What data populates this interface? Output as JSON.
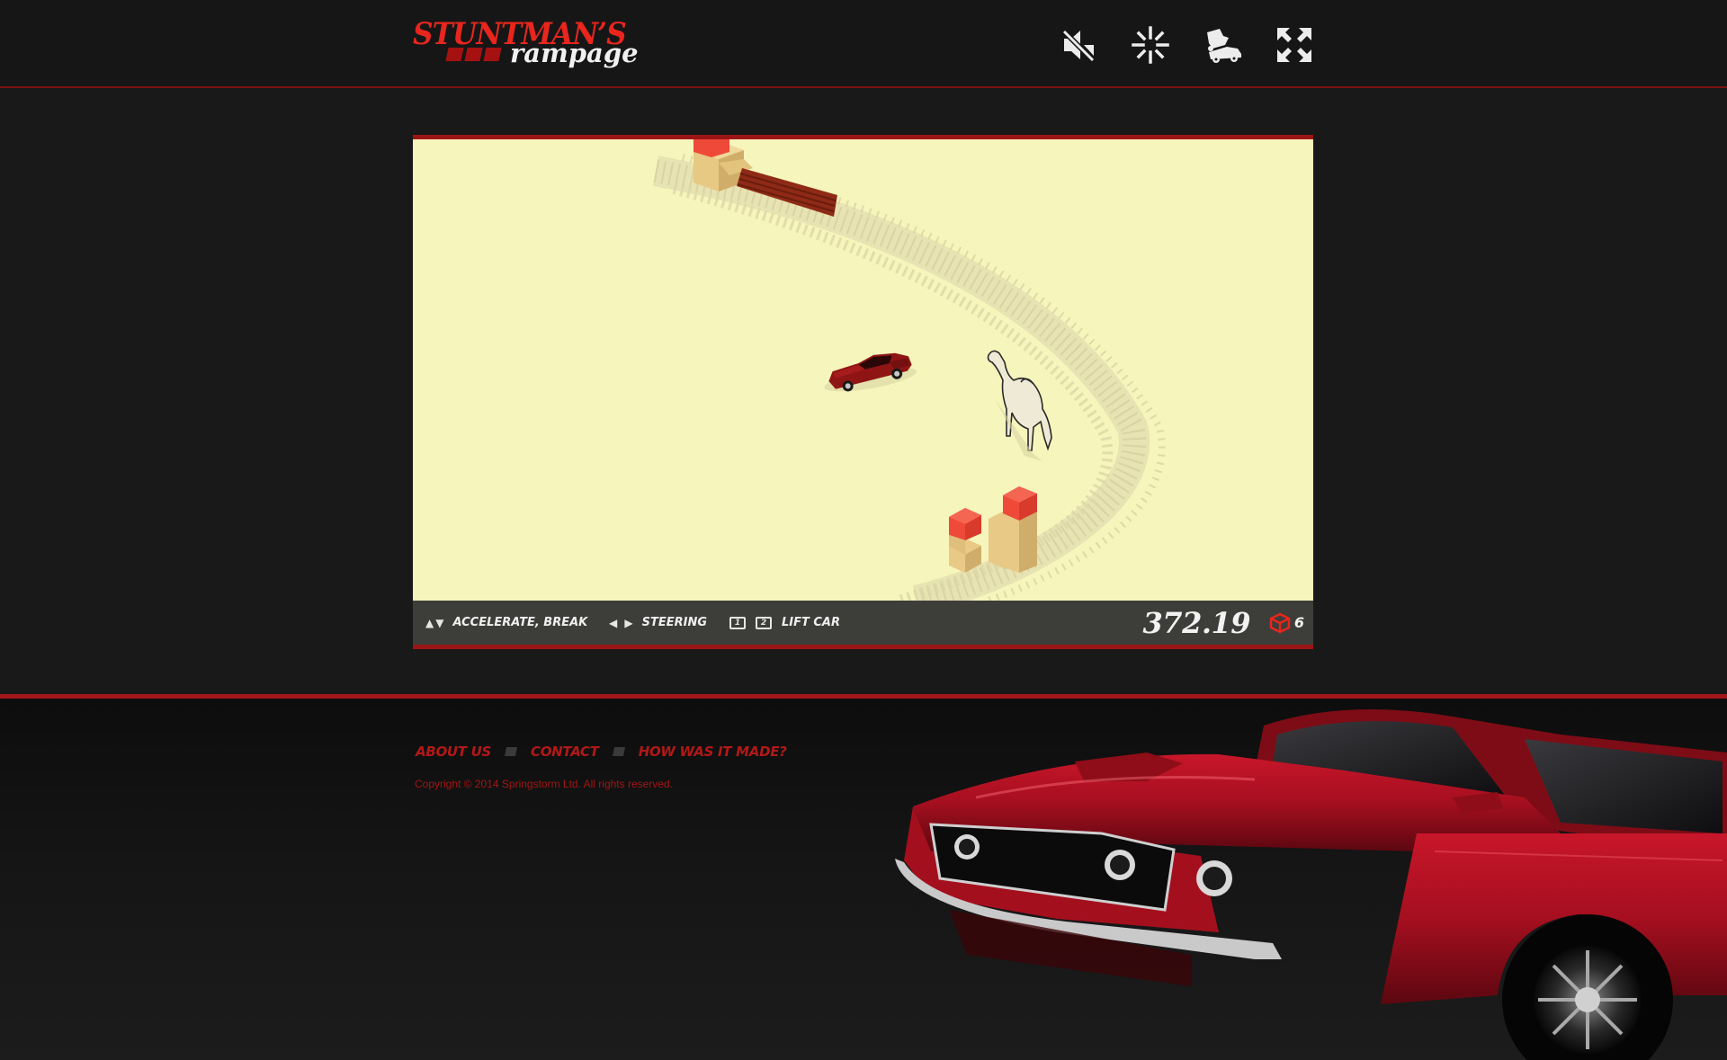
{
  "header": {
    "logo_title": "STUNTMAN’S",
    "logo_subtitle": "rampage",
    "buttons": [
      {
        "id": "mute",
        "icon": "speaker-muted-icon"
      },
      {
        "id": "quality",
        "icon": "loading-sparkle-icon"
      },
      {
        "id": "camera",
        "icon": "car-crash-icon"
      },
      {
        "id": "fullscreen",
        "icon": "fullscreen-icon"
      }
    ]
  },
  "game": {
    "hud": {
      "accelerate_label": "ACCELERATE, BREAK",
      "steering_label": "STEERING",
      "lift_key_1": "1",
      "lift_key_2": "2",
      "lift_label": "LIFT CAR",
      "score": "372.19",
      "boxes_count": "6"
    }
  },
  "footer": {
    "links": [
      "ABOUT US",
      "CONTACT",
      "HOW WAS IT MADE?"
    ],
    "copyright": "Copyright © 2014 Springstorm Ltd. All rights reserved."
  },
  "colors": {
    "accent_red": "#e8261d",
    "dark_red": "#9c1515",
    "sand": "#f6f5bb",
    "hud_bg": "#3d3d3a",
    "page_bg": "#191919"
  }
}
